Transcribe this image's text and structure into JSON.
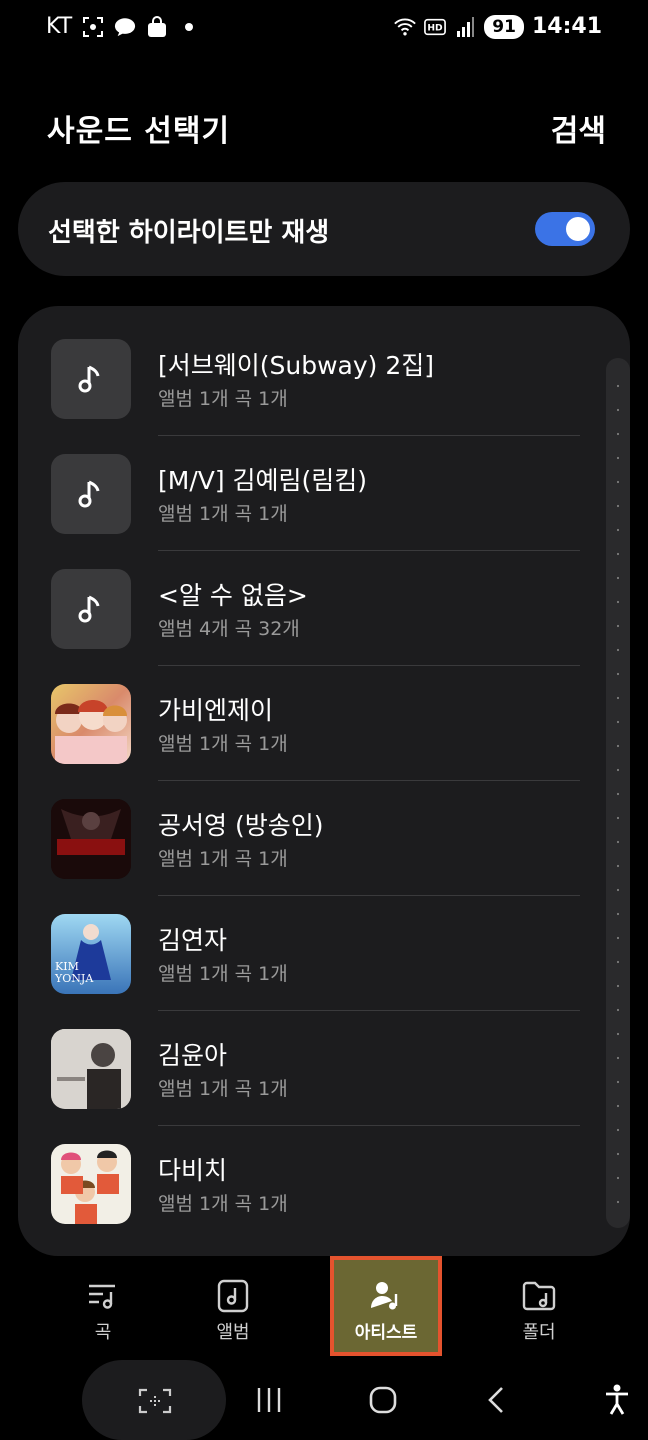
{
  "status_bar": {
    "carrier": "KT",
    "battery": "91",
    "time": "14:41",
    "icons": [
      "screenshot-icon",
      "talk-icon",
      "shopping-bag-icon",
      "dot-icon",
      "wifi-icon",
      "hd-icon",
      "signal-icon",
      "battery-icon"
    ]
  },
  "header": {
    "title": "사운드 선택기",
    "search": "검색"
  },
  "highlight": {
    "label": "선택한 하이라이트만 재생",
    "enabled": true
  },
  "artists": [
    {
      "name": "[서브웨이(Subway) 2집]",
      "meta": "앨범 1개  곡 1개",
      "thumb": "music-note-icon"
    },
    {
      "name": "[M/V] 김예림(림킴)",
      "meta": "앨범 1개  곡 1개",
      "thumb": "music-note-icon"
    },
    {
      "name": "<알 수 없음>",
      "meta": "앨범 4개  곡 32개",
      "thumb": "music-note-icon"
    },
    {
      "name": "가비엔제이",
      "meta": "앨범 1개  곡 1개",
      "thumb": "album-art"
    },
    {
      "name": "공서영 (방송인)",
      "meta": "앨범 1개  곡 1개",
      "thumb": "album-art"
    },
    {
      "name": "김연자",
      "meta": "앨범 1개  곡 1개",
      "thumb": "album-art"
    },
    {
      "name": "김윤아",
      "meta": "앨범 1개  곡 1개",
      "thumb": "album-art"
    },
    {
      "name": "다비치",
      "meta": "앨범 1개  곡 1개",
      "thumb": "album-art"
    }
  ],
  "album_art_text": {
    "kim_yonja": "KIM YONJA"
  },
  "bottom_tabs": [
    {
      "label": "곡",
      "icon": "song-list-icon"
    },
    {
      "label": "앨범",
      "icon": "album-icon"
    },
    {
      "label": "아티스트",
      "icon": "artist-icon",
      "active": true
    },
    {
      "label": "폴더",
      "icon": "folder-icon"
    }
  ],
  "colors": {
    "background": "#000000",
    "card": "#1c1c1e",
    "toggle_on": "#3b73e6",
    "active_tab_bg": "#6b6733",
    "active_tab_border": "#e4532e"
  }
}
